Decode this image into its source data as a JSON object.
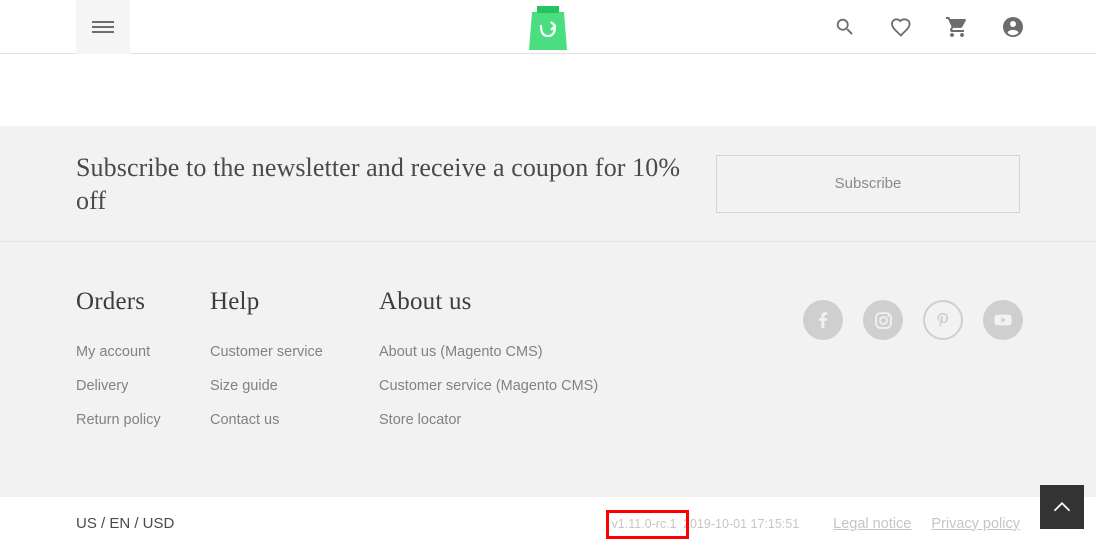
{
  "header": {
    "menu_icon": "hamburger-menu-icon",
    "logo_name": "shopping-bag-logo",
    "actions": [
      {
        "name": "search-icon",
        "label": "Search"
      },
      {
        "name": "wishlist-heart-icon",
        "label": "Wishlist"
      },
      {
        "name": "shopping-cart-icon",
        "label": "Cart"
      },
      {
        "name": "account-icon",
        "label": "Account"
      }
    ]
  },
  "newsletter": {
    "heading": "Subscribe to the newsletter and receive a coupon for 10% off",
    "button_label": "Subscribe"
  },
  "footer": {
    "columns": [
      {
        "title": "Orders",
        "links": [
          "My account",
          "Delivery",
          "Return policy"
        ]
      },
      {
        "title": "Help",
        "links": [
          "Customer service",
          "Size guide",
          "Contact us"
        ]
      },
      {
        "title": "About us",
        "links": [
          "About us (Magento CMS)",
          "Customer service (Magento CMS)",
          "Store locator"
        ]
      }
    ],
    "social": [
      {
        "name": "facebook-icon",
        "label": "Facebook"
      },
      {
        "name": "instagram-icon",
        "label": "Instagram"
      },
      {
        "name": "pinterest-icon",
        "label": "Pinterest"
      },
      {
        "name": "youtube-icon",
        "label": "YouTube"
      }
    ]
  },
  "bottombar": {
    "locale": "US / EN / USD",
    "version": "v1.11.0-rc.1",
    "build_time": "2019-10-01 17:15:51",
    "links": [
      "Legal notice",
      "Privacy policy"
    ],
    "highlight_color": "#ff0000"
  },
  "scroll_top": {
    "icon": "chevron-up-icon"
  }
}
